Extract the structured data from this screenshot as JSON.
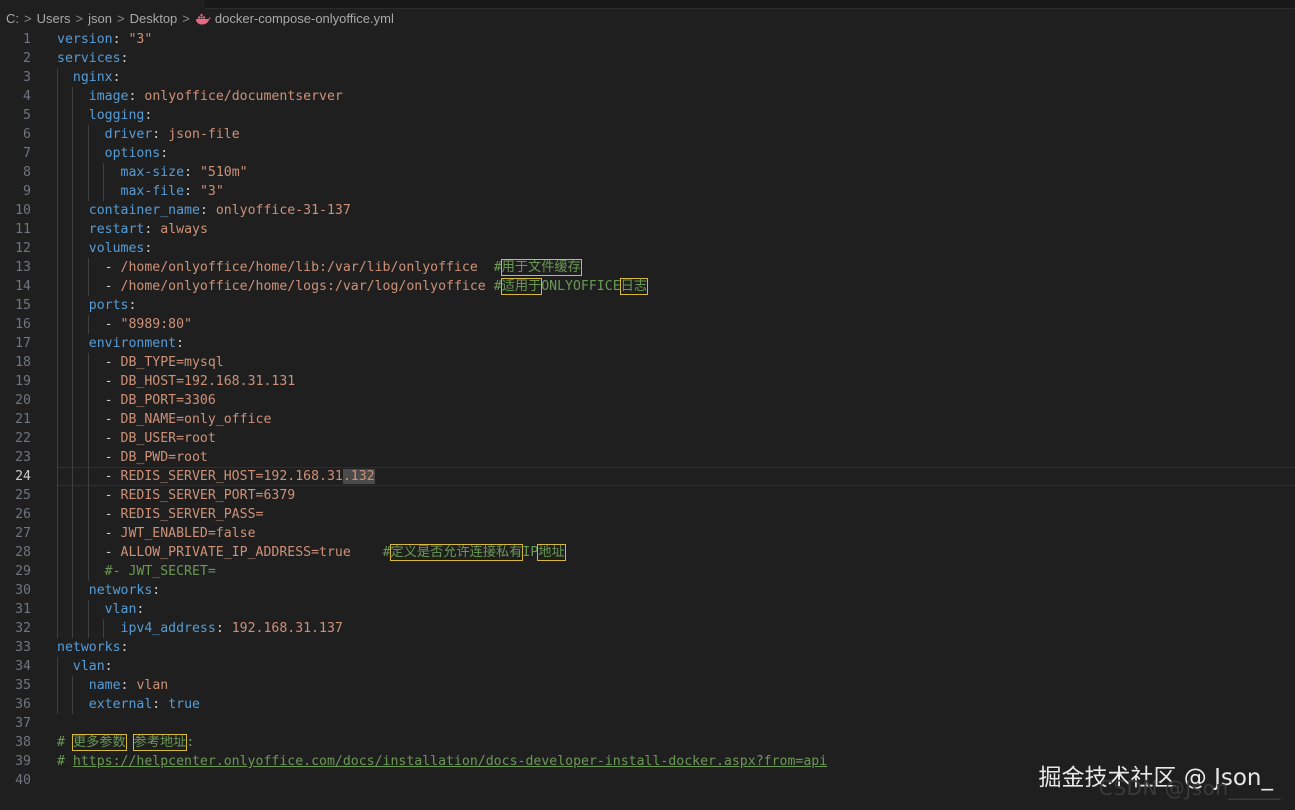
{
  "breadcrumb": {
    "items": [
      "C:",
      "Users",
      "json",
      "Desktop"
    ],
    "file": "docker-compose-onlyoffice.yml",
    "file_icon": "docker-whale-icon"
  },
  "editor": {
    "active_line": 24,
    "lines": [
      {
        "n": "1",
        "code": "version: \"3\""
      },
      {
        "n": "2",
        "code": "services:"
      },
      {
        "n": "3",
        "code": "  nginx:"
      },
      {
        "n": "4",
        "code": "    image: onlyoffice/documentserver"
      },
      {
        "n": "5",
        "code": "    logging:"
      },
      {
        "n": "6",
        "code": "      driver: json-file"
      },
      {
        "n": "7",
        "code": "      options:"
      },
      {
        "n": "8",
        "code": "        max-size: \"510m\""
      },
      {
        "n": "9",
        "code": "        max-file: \"3\""
      },
      {
        "n": "10",
        "code": "    container_name: onlyoffice-31-137"
      },
      {
        "n": "11",
        "code": "    restart: always"
      },
      {
        "n": "12",
        "code": "    volumes:"
      },
      {
        "n": "13",
        "code": "      - /home/onlyoffice/home/lib:/var/lib/onlyoffice  #用于文件缓存"
      },
      {
        "n": "14",
        "code": "      - /home/onlyoffice/home/logs:/var/log/onlyoffice #适用于ONLYOFFICE日志"
      },
      {
        "n": "15",
        "code": "    ports:"
      },
      {
        "n": "16",
        "code": "      - \"8989:80\""
      },
      {
        "n": "17",
        "code": "    environment:"
      },
      {
        "n": "18",
        "code": "      - DB_TYPE=mysql"
      },
      {
        "n": "19",
        "code": "      - DB_HOST=192.168.31.131"
      },
      {
        "n": "20",
        "code": "      - DB_PORT=3306"
      },
      {
        "n": "21",
        "code": "      - DB_NAME=only_office"
      },
      {
        "n": "22",
        "code": "      - DB_USER=root"
      },
      {
        "n": "23",
        "code": "      - DB_PWD=root"
      },
      {
        "n": "24",
        "code": "      - REDIS_SERVER_HOST=192.168.31.132"
      },
      {
        "n": "25",
        "code": "      - REDIS_SERVER_PORT=6379"
      },
      {
        "n": "26",
        "code": "      - REDIS_SERVER_PASS="
      },
      {
        "n": "27",
        "code": "      - JWT_ENABLED=false"
      },
      {
        "n": "28",
        "code": "      - ALLOW_PRIVATE_IP_ADDRESS=true    #定义是否允许连接私有IP地址"
      },
      {
        "n": "29",
        "code": "      #- JWT_SECRET="
      },
      {
        "n": "30",
        "code": "    networks:"
      },
      {
        "n": "31",
        "code": "      vlan:"
      },
      {
        "n": "32",
        "code": "        ipv4_address: 192.168.31.137"
      },
      {
        "n": "33",
        "code": "networks:"
      },
      {
        "n": "34",
        "code": "  vlan:"
      },
      {
        "n": "35",
        "code": "    name: vlan"
      },
      {
        "n": "36",
        "code": "    external: true"
      },
      {
        "n": "37",
        "code": ""
      },
      {
        "n": "38",
        "code": "# 更多参数 参考地址:"
      },
      {
        "n": "39",
        "code": "# https://helpcenter.onlyoffice.com/docs/installation/docs-developer-install-docker.aspx?from=api"
      },
      {
        "n": "40",
        "code": ""
      }
    ]
  },
  "watermark": {
    "text": "掘金技术社区 @ Json_",
    "text2": "CSDN @Json_____"
  },
  "colors": {
    "background": "#1f1f1f",
    "key": "#569cd6",
    "string": "#ce9178",
    "comment": "#6a9955",
    "highlight_box": "#d7ba3d"
  }
}
